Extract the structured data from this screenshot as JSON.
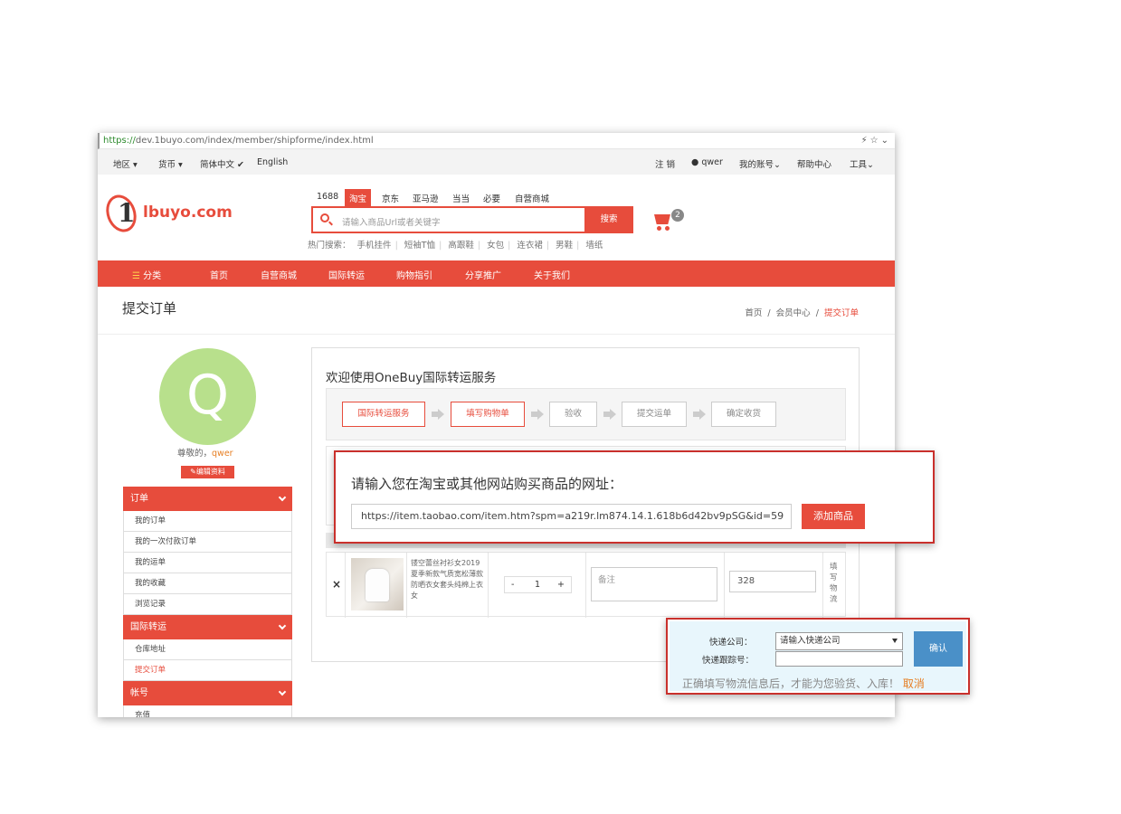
{
  "browser": {
    "url_scheme": "https://",
    "url_rest": "dev.1buyo.com/index/member/shipforme/index.html",
    "tools": "⚡☆⌄"
  },
  "topbar": {
    "region": "地区 ▾",
    "currency": "货币 ▾",
    "lang_cn": "简体中文 ✔",
    "lang_en": "English",
    "logout": "注 销",
    "user": "qwer",
    "account": "我的账号⌄",
    "help": "帮助中心",
    "tools": "工具⌄"
  },
  "logo": {
    "one": "1",
    "text": "lbuyo.com"
  },
  "search": {
    "tabs": [
      "1688",
      "淘宝",
      "京东",
      "亚马逊",
      "当当",
      "必要",
      "自营商城"
    ],
    "placeholder": "请输入商品Url或者关键字",
    "button": "搜索",
    "hot_label": "热门搜索：",
    "hot": [
      "手机挂件",
      "短袖T恤",
      "高跟鞋",
      "女包",
      "连衣裙",
      "男鞋",
      "墙纸"
    ]
  },
  "cart": {
    "count": "2"
  },
  "nav": {
    "items": [
      "分类",
      "首页",
      "自营商城",
      "国际转运",
      "购物指引",
      "分享推广",
      "关于我们"
    ]
  },
  "page": {
    "title": "提交订单",
    "breadcrumb": [
      "首页",
      "/",
      "会员中心",
      "/",
      "提交订单"
    ]
  },
  "profile": {
    "initial": "Q",
    "greeting": "尊敬的，",
    "username": "qwer",
    "edit": "编辑资料"
  },
  "sidebar": {
    "groups": [
      {
        "title": "订单",
        "items": [
          "我的订单",
          "我的一次付款订单",
          "我的运单",
          "我的收藏",
          "浏览记录"
        ]
      },
      {
        "title": "国际转运",
        "items": [
          "仓库地址",
          "提交订单"
        ]
      },
      {
        "title": "帐号",
        "items": [
          "充值"
        ]
      }
    ]
  },
  "main": {
    "title": "欢迎使用OneBuy国际转运服务",
    "steps": [
      "国际转运服务",
      "填写购物单",
      "验收",
      "提交运单",
      "确定收货"
    ],
    "product": {
      "remove": "×",
      "desc": "镂空蕾丝衬衫女2019夏季新款气质宽松薄款防晒衣女套头纯棉上衣女",
      "qty_minus": "-",
      "qty": "1",
      "qty_plus": "+",
      "note_placeholder": "备注",
      "price": "328",
      "track": "填写物流"
    }
  },
  "url_popup": {
    "question": "请输入您在淘宝或其他网站购买商品的网址：",
    "url": "https://item.taobao.com/item.htm?spm=a219r.lm874.14.1.618b6d42bv9pSG&id=59",
    "button": "添加商品"
  },
  "ship_popup": {
    "company_label": "快递公司：",
    "tracking_label": "快递跟踪号：",
    "company_placeholder": "请输入快递公司",
    "confirm": "确认",
    "tip": "正确填写物流信息后，才能为您验货、入库！",
    "cancel": "取消"
  }
}
